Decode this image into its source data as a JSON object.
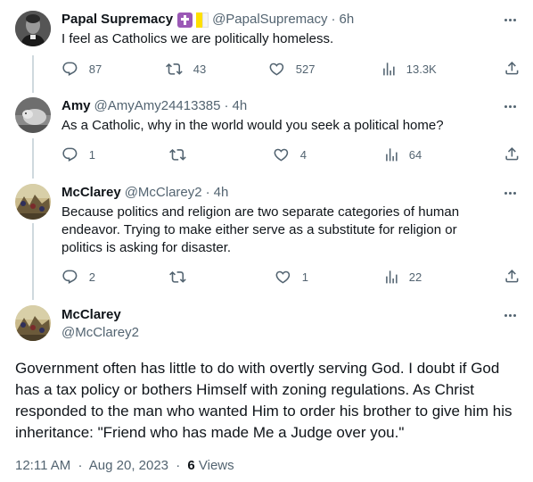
{
  "tweets": [
    {
      "name": "Papal Supremacy",
      "handle": "@PapalSupremacy",
      "time": "6h",
      "text": "I feel as Catholics we are politically homeless.",
      "replies": "87",
      "retweets": "43",
      "likes": "527",
      "views": "13.3K"
    },
    {
      "name": "Amy",
      "handle": "@AmyAmy24413385",
      "time": "4h",
      "text": "As a Catholic,  why in the world would you seek a political home?",
      "replies": "1",
      "retweets": "",
      "likes": "4",
      "views": "64"
    },
    {
      "name": "McClarey",
      "handle": "@McClarey2",
      "time": "4h",
      "text": "Because politics and religion are two separate categories of human endeavor.  Trying to make either serve as a substitute  for religion or politics is asking for disaster.",
      "replies": "2",
      "retweets": "",
      "likes": "1",
      "views": "22"
    }
  ],
  "main": {
    "name": "McClarey",
    "handle": "@McClarey2",
    "text": "Government often has little to do with overtly serving God.  I doubt if God has a tax policy or bothers Himself with zoning regulations.  As Christ responded to the man who wanted Him to order his brother to give him his inheritance:  \"Friend who has made Me a Judge over you.\"",
    "time": "12:11 AM",
    "date": "Aug 20, 2023",
    "views_count": "6",
    "views_label": "Views"
  },
  "dot": "·",
  "icons": {
    "reply": "reply-icon",
    "retweet": "retweet-icon",
    "like": "like-icon",
    "views": "views-icon",
    "share": "share-icon",
    "more": "more-icon",
    "verified": "cross-badge-icon",
    "flag": "vatican-flag-icon"
  },
  "colors": {
    "text": "#0f1419",
    "secondary": "#536471",
    "thread_line": "#cfd9de",
    "badge": "#9b59b6"
  }
}
